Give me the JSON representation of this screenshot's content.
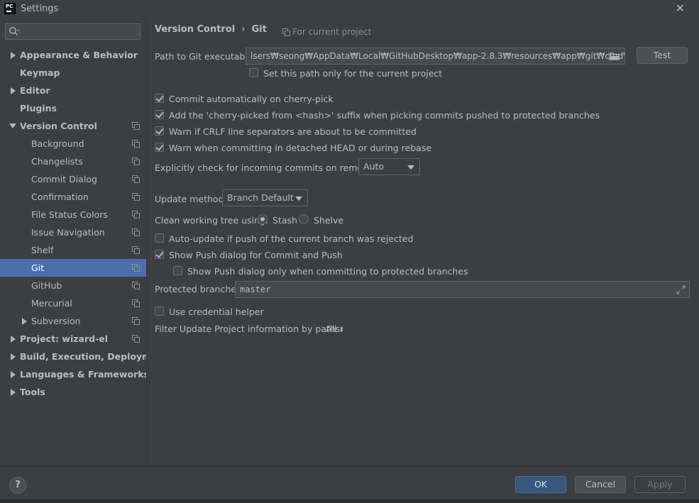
{
  "window": {
    "title": "Settings",
    "logo_text": "PC"
  },
  "search": {
    "placeholder": "",
    "value": ""
  },
  "sidebar": {
    "items": [
      {
        "label": "Appearance & Behavior",
        "level": 0,
        "arrow": "right",
        "copy": false
      },
      {
        "label": "Keymap",
        "level": 0,
        "arrow": "none",
        "copy": false
      },
      {
        "label": "Editor",
        "level": 0,
        "arrow": "right",
        "copy": false
      },
      {
        "label": "Plugins",
        "level": 0,
        "arrow": "none",
        "copy": false
      },
      {
        "label": "Version Control",
        "level": 0,
        "arrow": "down",
        "copy": true
      },
      {
        "label": "Background",
        "level": 1,
        "arrow": "none",
        "copy": true
      },
      {
        "label": "Changelists",
        "level": 1,
        "arrow": "none",
        "copy": true
      },
      {
        "label": "Commit Dialog",
        "level": 1,
        "arrow": "none",
        "copy": true
      },
      {
        "label": "Confirmation",
        "level": 1,
        "arrow": "none",
        "copy": true
      },
      {
        "label": "File Status Colors",
        "level": 1,
        "arrow": "none",
        "copy": true
      },
      {
        "label": "Issue Navigation",
        "level": 1,
        "arrow": "none",
        "copy": true
      },
      {
        "label": "Shelf",
        "level": 1,
        "arrow": "none",
        "copy": true
      },
      {
        "label": "Git",
        "level": 1,
        "arrow": "none",
        "copy": true,
        "selected": true
      },
      {
        "label": "GitHub",
        "level": 1,
        "arrow": "none",
        "copy": true
      },
      {
        "label": "Mercurial",
        "level": 1,
        "arrow": "none",
        "copy": true
      },
      {
        "label": "Subversion",
        "level": 1,
        "arrow": "right",
        "copy": true
      },
      {
        "label": "Project: wizard-el",
        "level": 0,
        "arrow": "right",
        "copy": true
      },
      {
        "label": "Build, Execution, Deployment",
        "level": 0,
        "arrow": "right",
        "copy": false
      },
      {
        "label": "Languages & Frameworks",
        "level": 0,
        "arrow": "right",
        "copy": false
      },
      {
        "label": "Tools",
        "level": 0,
        "arrow": "right",
        "copy": false
      }
    ]
  },
  "breadcrumb": {
    "parent": "Version Control",
    "separator": "›",
    "current": "Git"
  },
  "scope_label": "For current project",
  "git_path": {
    "label": "Path to Git executable:",
    "value": "lsers₩seong₩AppData₩Local₩GitHubDesktop₩app-2.8.3₩resources₩app₩git₩cmd₩git.exe",
    "test_label": "Test",
    "project_only_label": "Set this path only for the current project",
    "project_only_checked": false
  },
  "options": {
    "commit_cherry_pick": {
      "label": "Commit automatically on cherry-pick",
      "checked": true
    },
    "cherry_suffix": {
      "label": "Add the 'cherry-picked from <hash>' suffix when picking commits pushed to protected branches",
      "checked": true
    },
    "warn_crlf": {
      "label": "Warn if CRLF line separators are about to be committed",
      "checked": true
    },
    "warn_detached": {
      "label": "Warn when committing in detached HEAD or during rebase",
      "checked": true
    }
  },
  "incoming": {
    "label": "Explicitly check for incoming commits on remotes:",
    "value": "Auto"
  },
  "update_method": {
    "label": "Update method:",
    "value": "Branch Default"
  },
  "clean_tree": {
    "label": "Clean working tree using:",
    "options": [
      "Stash",
      "Shelve"
    ],
    "selected": "Stash"
  },
  "push": {
    "auto_update": {
      "label": "Auto-update if push of the current branch was rejected",
      "checked": false
    },
    "show_dialog": {
      "label": "Show Push dialog for Commit and Push",
      "checked": true
    },
    "protected_only": {
      "label": "Show Push dialog only when committing to protected branches",
      "checked": false
    }
  },
  "protected_branches": {
    "label": "Protected branches:",
    "value": "master"
  },
  "credential_helper": {
    "label": "Use credential helper",
    "checked": false
  },
  "filter_update": {
    "label": "Filter Update Project information by paths:",
    "value": "All"
  },
  "footer": {
    "help": "?",
    "ok": "OK",
    "cancel": "Cancel",
    "apply": "Apply"
  },
  "colors": {
    "selection": "#4b6eaf",
    "primary_button": "#365880",
    "background": "#3c3f41"
  }
}
